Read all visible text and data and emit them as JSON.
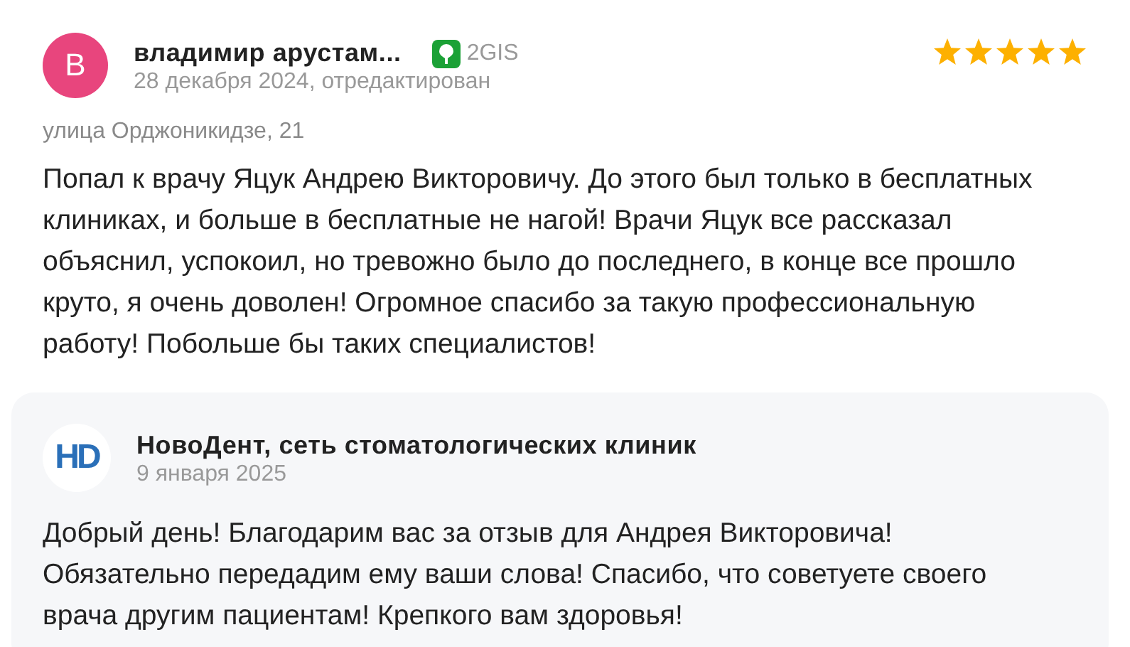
{
  "review": {
    "avatar_letter": "В",
    "author": "владимир арустам...",
    "source": "2GIS",
    "date": "28 декабря 2024, отредактирован",
    "stars": 5,
    "address": "улица Орджоникидзе, 21",
    "text": "Попал к врачу Яцук Андрею Викторовичу. До этого был только в бесплатных клиниках, и больше в бесплатные не нагой! Врачи Яцук все рассказал объяснил, успокоил, но тревожно было до последнего, в конце все прошло круто, я очень доволен! Огромное спасибо за такую профессиональную работу! Побольше бы таких специалистов!"
  },
  "reply": {
    "logo_text": "HD",
    "author": "НовоДент, сеть стоматологических клиник",
    "date": "9 января 2025",
    "text": "Добрый день! Благодарим вас за отзыв для Андрея Викторовича! Обязательно передадим ему ваши слова! Спасибо, что советуете своего врача другим пациентам! Крепкого вам здоровья!"
  }
}
